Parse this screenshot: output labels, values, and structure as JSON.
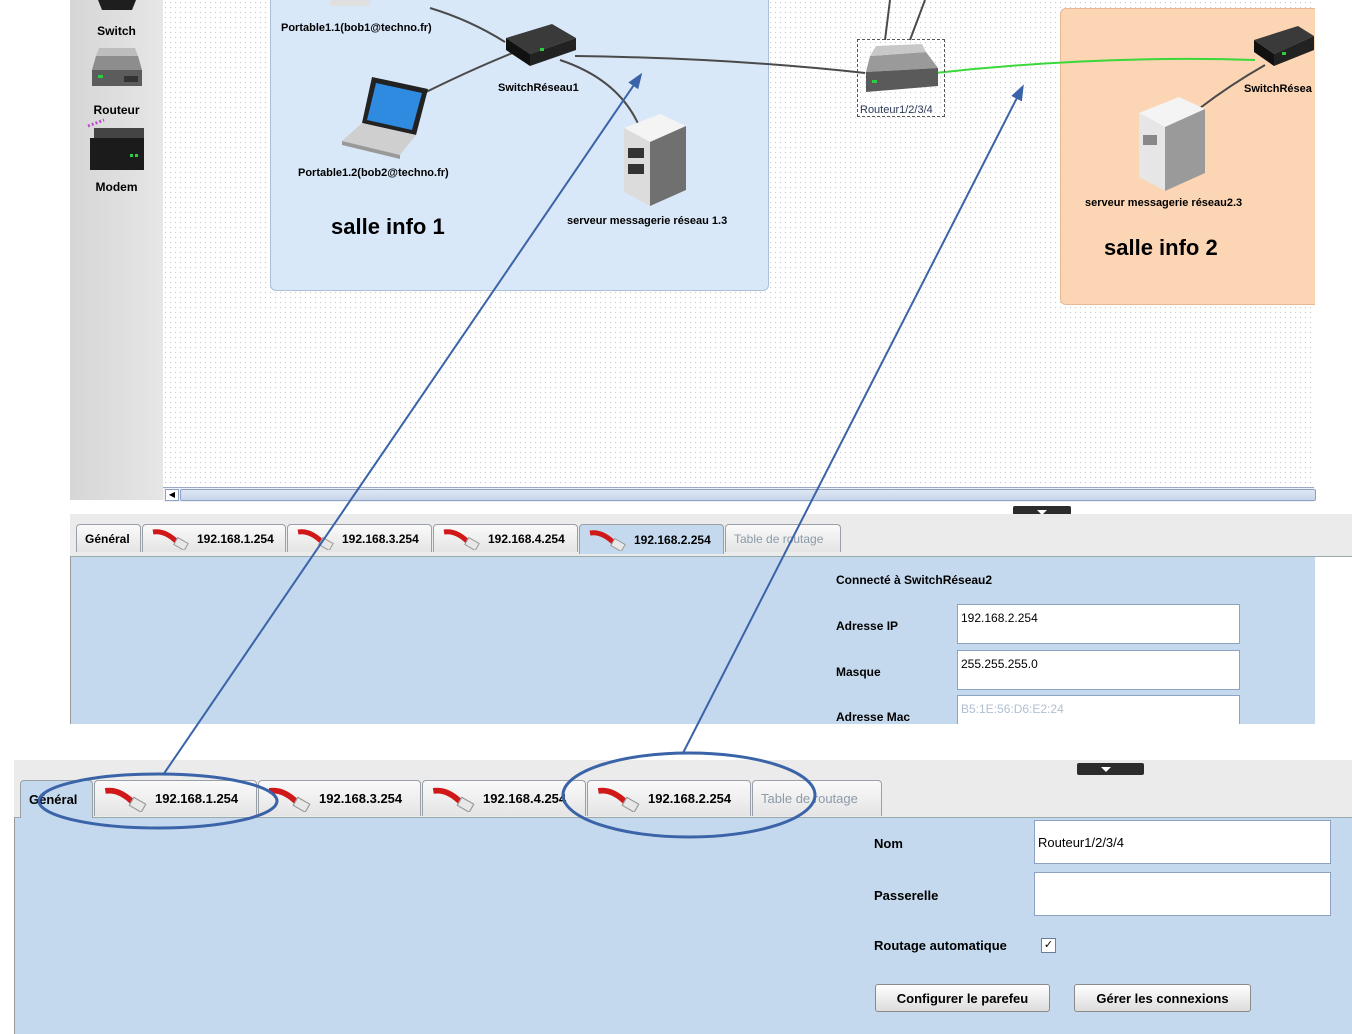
{
  "palette": {
    "items": [
      {
        "label": "Switch"
      },
      {
        "label": "Routeur"
      },
      {
        "label": "Modem"
      }
    ]
  },
  "network": {
    "room1": {
      "title": "salle info 1",
      "portable1": "Portable1.1(bob1@techno.fr)",
      "portable2": "Portable1.2(bob2@techno.fr)",
      "switch": "SwitchRéseau1",
      "server": "serveur messagerie réseau 1.3"
    },
    "router": "Routeur1/2/3/4",
    "room2": {
      "title": "salle info 2",
      "switch": "SwitchRésea",
      "server": "serveur messagerie réseau2.3"
    },
    "colors": {
      "room1": "#d9e8f8",
      "room2": "#fcd5b4",
      "active_link": "#3ad83a",
      "annotation": "#3a63a8"
    }
  },
  "top_panel": {
    "tabs": [
      {
        "label": "Général"
      },
      {
        "label": "192.168.1.254"
      },
      {
        "label": "192.168.3.254"
      },
      {
        "label": "192.168.4.254"
      },
      {
        "label": "192.168.2.254",
        "active": true
      },
      {
        "label": "Table de routage"
      }
    ],
    "connected_label": "Connecté à SwitchRéseau2",
    "ip_label": "Adresse IP",
    "ip_value": "192.168.2.254",
    "mask_label": "Masque",
    "mask_value": "255.255.255.0",
    "mac_label": "Adresse Mac",
    "mac_value": "B5:1E:56:D6:E2:24"
  },
  "bottom_panel": {
    "tabs": [
      {
        "label": "Général",
        "active": true
      },
      {
        "label": "192.168.1.254"
      },
      {
        "label": "192.168.3.254"
      },
      {
        "label": "192.168.4.254"
      },
      {
        "label": "192.168.2.254"
      },
      {
        "label": "Table de routage"
      }
    ],
    "name_label": "Nom",
    "name_value": "Routeur1/2/3/4",
    "gateway_label": "Passerelle",
    "gateway_value": "",
    "auto_routing_label": "Routage automatique",
    "auto_routing_checked": true,
    "firewall_button": "Configurer le parefeu",
    "connections_button": "Gérer les connexions"
  }
}
